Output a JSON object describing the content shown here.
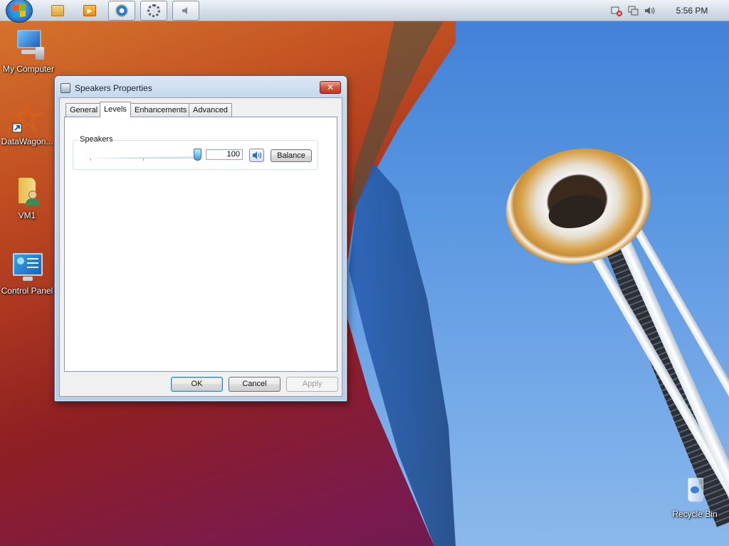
{
  "taskbar": {
    "pinned": [
      {
        "name": "explorer-icon",
        "color": "#e8b64c"
      },
      {
        "name": "media-player-icon",
        "color": "#f0a020"
      },
      {
        "name": "internet-explorer-icon",
        "color": "#2b7bd6"
      },
      {
        "name": "gear-app-icon",
        "color": "#6a7784"
      },
      {
        "name": "speaker-app-icon",
        "color": "#7f8a96"
      }
    ],
    "tray": [
      "network-error-icon",
      "network-icon",
      "volume-icon"
    ],
    "clock": "5:56 PM"
  },
  "desktop": {
    "icons": [
      {
        "label": "My Computer",
        "icon": "computer-icon"
      },
      {
        "label": "DataWagon...",
        "icon": "datawagon-shortcut-icon"
      },
      {
        "label": "VM1",
        "icon": "user-folder-icon"
      },
      {
        "label": "Control Panel",
        "icon": "control-panel-icon"
      },
      {
        "label": "Recycle Bin",
        "icon": "recycle-bin-icon"
      }
    ]
  },
  "dialog": {
    "title": "Speakers Properties",
    "close_label": "✕",
    "tabs": [
      {
        "label": "General",
        "active": false
      },
      {
        "label": "Levels",
        "active": true
      },
      {
        "label": "Enhancements",
        "active": false
      },
      {
        "label": "Advanced",
        "active": false
      }
    ],
    "levels": {
      "group_label": "Speakers",
      "level_value": "100",
      "level_fraction": 1.0,
      "balance_label": "Balance",
      "muted": false
    },
    "buttons": {
      "ok": "OK",
      "cancel": "Cancel",
      "apply": "Apply"
    }
  },
  "colors": {
    "accent": "#3c7fb1",
    "slider_thumb": "#6cc1ea",
    "close_button": "#c23a22"
  }
}
